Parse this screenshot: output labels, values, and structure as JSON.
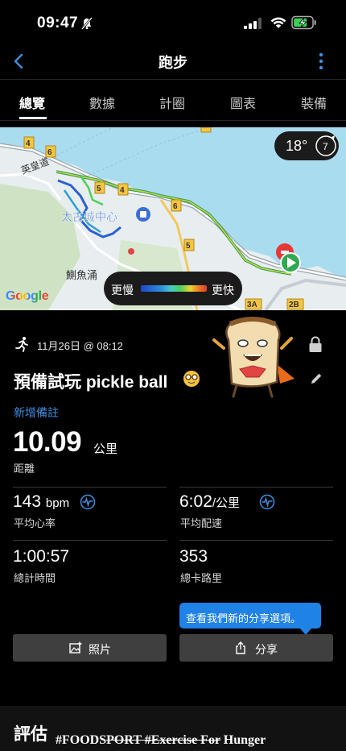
{
  "status_bar": {
    "time": "09:47"
  },
  "nav": {
    "title": "跑步"
  },
  "tabs": [
    {
      "label": "總覽",
      "active": true
    },
    {
      "label": "數據",
      "active": false
    },
    {
      "label": "計圈",
      "active": false
    },
    {
      "label": "圖表",
      "active": false
    },
    {
      "label": "裝備",
      "active": false
    }
  ],
  "map": {
    "temperature": "18°",
    "weather_number": "7",
    "legend_slow": "更慢",
    "legend_fast": "更快",
    "google": "Google",
    "place_label_1": "太古城中心",
    "place_label_2": "鰂魚涌",
    "road_label": "英皇道",
    "route_badges": [
      "5",
      "4",
      "6",
      "5",
      "4",
      "6",
      "5",
      "3A",
      "2B"
    ]
  },
  "activity": {
    "date": "11月26日 @ 08:12",
    "title": "預備試玩 pickle ball",
    "add_note": "新增備註",
    "distance_value": "10.09",
    "distance_unit": "公里",
    "distance_label": "距離",
    "heart_rate_value": "143",
    "heart_rate_unit": "bpm",
    "heart_rate_label": "平均心率",
    "pace_value": "6:02",
    "pace_unit": "/公里",
    "pace_label": "平均配速",
    "time_value": "1:00:57",
    "time_label": "總計時間",
    "calories_value": "353",
    "calories_label": "總卡路里"
  },
  "tooltip": {
    "text": "查看我們新的分享選項。"
  },
  "buttons": {
    "photo": "照片",
    "share": "分享"
  },
  "evaluation": {
    "title": "評估"
  },
  "watermark": {
    "part1": "#FOODS",
    "part2": "PORT #Exercise For",
    "part3": " Hunger"
  },
  "colors": {
    "accent": "#1f82e6",
    "link": "#3f8ee0",
    "background": "#000000"
  }
}
